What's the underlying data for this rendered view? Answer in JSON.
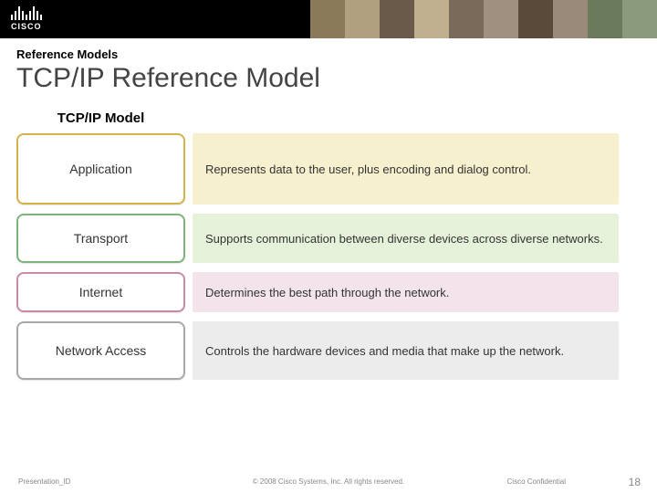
{
  "brand": {
    "name": "CISCO"
  },
  "header": {
    "eyebrow": "Reference Models",
    "title": "TCP/IP Reference Model"
  },
  "model": {
    "heading": "TCP/IP Model",
    "layers": [
      {
        "name": "Application",
        "desc": "Represents data to the user, plus encoding and dialog control."
      },
      {
        "name": "Transport",
        "desc": "Supports communication between diverse devices across diverse networks."
      },
      {
        "name": "Internet",
        "desc": "Determines the best path through the network."
      },
      {
        "name": "Network Access",
        "desc": "Controls the hardware devices and media that make up the network."
      }
    ]
  },
  "footer": {
    "left": "Presentation_ID",
    "center": "© 2008 Cisco Systems, Inc. All rights reserved.",
    "confidential": "Cisco Confidential",
    "page": "18"
  }
}
